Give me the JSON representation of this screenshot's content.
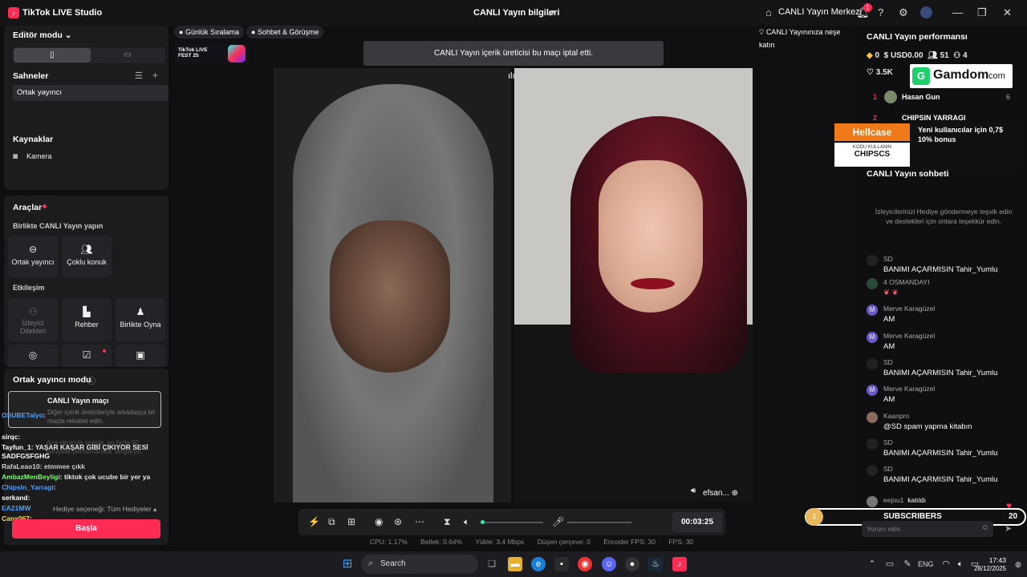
{
  "titlebar": {
    "app_name": "TikTok LIVE Studio",
    "center_title": "CANLI Yayın bilgileri",
    "live_center": "CANLI Yayın Merkezi",
    "notification_count": "1"
  },
  "left": {
    "editor_mode": "Editör modu",
    "scenes_title": "Sahneler",
    "scene_item": "Ortak yayıncı",
    "sources_title": "Kaynaklar",
    "source_camera": "Kamera",
    "tools_title": "Araçlar",
    "together_live": "Birlikte CANLI Yayın yapın",
    "tile_cohost": "Ortak yayıncı",
    "tile_multi": "Çoklu konuk",
    "engagement": "Etkileşim",
    "tile_viewer_wishes": "İzleyici Dilekleri",
    "tile_guide": "Rehber",
    "tile_play_together": "Birlikte Oyna",
    "cohost_mode": "Ortak yayıncı modu",
    "match_title": "CANLI Yayın maçı",
    "match_desc": "Diğer içerik üreticileriyle arkadaşça bir maçta rekabet edin.",
    "solo_desc": "Ana ekranda sırayla, en fazla 90 saniyelik performanslar sergileyin.",
    "gift_option": "Hediye seçeneği: Tüm Hediyeler",
    "start_button": "Başla",
    "chat_lines": [
      {
        "user": "OSUBETalyo",
        "text": ":",
        "color": "#4da3ff"
      },
      {
        "user": "sirqc",
        "text": ":",
        "color": "#ffffff"
      },
      {
        "user": "Tayfun_1",
        "text": ": YAŞAR KAŞAR GİBİ ÇIKIYOR SESİ",
        "color": "#ffffff"
      },
      {
        "user": "SADFGSFGHG",
        "text": "",
        "color": "#ffffff"
      },
      {
        "user": "RafaLeao10",
        "text": ": etmmee çıkk",
        "color": "#cccccc"
      },
      {
        "user": "AmbazMenBeyligi",
        "text": ": tiktok çok ucube bir yer ya",
        "color": "#7bff6b"
      },
      {
        "user": "Chipsln_Yarragi",
        "text": ":",
        "color": "#4da3ff"
      },
      {
        "user": "serkand",
        "text": ":",
        "color": "#ffffff"
      },
      {
        "user": "EA21MW",
        "text": "",
        "color": "#4da3ff"
      },
      {
        "user": "Canx067",
        "text": ":",
        "color": "#ffdb4d"
      }
    ]
  },
  "center": {
    "chip_ranking": "Günlük Sıralama",
    "chip_chat": "Sohbet & Görüşme",
    "chip_invite": "CANLI Yayınınıza neşe katın",
    "banner": "CANLI Yayın içerik üreticisi bu maçı iptal etti.",
    "fest_label": "TikTok LIVE FEST 25",
    "video_name_right": "efsan...",
    "timer": "00:03:25",
    "stats": {
      "cpu": "CPU:  1.17%",
      "memory": "Bellek:  0.64%",
      "upload": "Yükle:  3.4 Mbps",
      "dropped": "Düşen çerçeve:  0",
      "encoder": "Encoder FPS:  30",
      "fps": "FPS:  30"
    }
  },
  "right": {
    "perf_title": "CANLI Yayın performansı",
    "diamonds": "0",
    "usd": "USD0.00",
    "viewers": "51",
    "followers": "4",
    "likes": "3.5K",
    "gamdom": "Gamdom",
    "gamdom_suffix": ".com",
    "rank1_pos": "1",
    "rank1_name": "Hasan Gun",
    "rank1_score": "6",
    "rank2_pos": "2",
    "rank2_name": "CHIPSIN YARRAGI",
    "hellcase": "Hellcase",
    "hellcase_code_label": "KODU KULLANIN",
    "hellcase_code": "CHIPSCS",
    "hellcase_offer": "Yeni kullanıcılar için 0,7$ 10% bonus",
    "chat_title": "CANLI Yayın sohbeti",
    "chat_hint": "İzleyicilerinizi Hediye göndermeye teşvik edin ve destekleri için onlara teşekkür edin.",
    "messages": [
      {
        "user": "SD",
        "text": "BANIMI AÇARMISIN Tahir_Yumlu"
      },
      {
        "user": "4 OSMANDAYI",
        "text": ""
      },
      {
        "user": "Merve Karagüzel",
        "text": "AM"
      },
      {
        "user": "Merve Karagüzel",
        "text": "AM"
      },
      {
        "user": "SD",
        "text": "BANIMI AÇARMISIN Tahir_Yumlu"
      },
      {
        "user": "Merve Karagüzel",
        "text": "AM"
      },
      {
        "user": "Kaanpro",
        "text": "@SD spam yapma kitabın"
      },
      {
        "user": "SD",
        "text": "BANIMI AÇARMISIN Tahir_Yumlu"
      },
      {
        "user": "SD",
        "text": "BANIMI AÇARMISIN Tahir_Yumlu"
      }
    ],
    "joined_user": "eejou1",
    "joined_text": "katıldı",
    "subscribers_label": "SUBSCRIBERS",
    "subscribers_count": "20",
    "subscribers_progress": "1",
    "comment_placeholder": "Yorum ekle"
  },
  "taskbar": {
    "search": "Search",
    "lang": "ENG",
    "time": "17:43",
    "date": "28/12/2025"
  }
}
